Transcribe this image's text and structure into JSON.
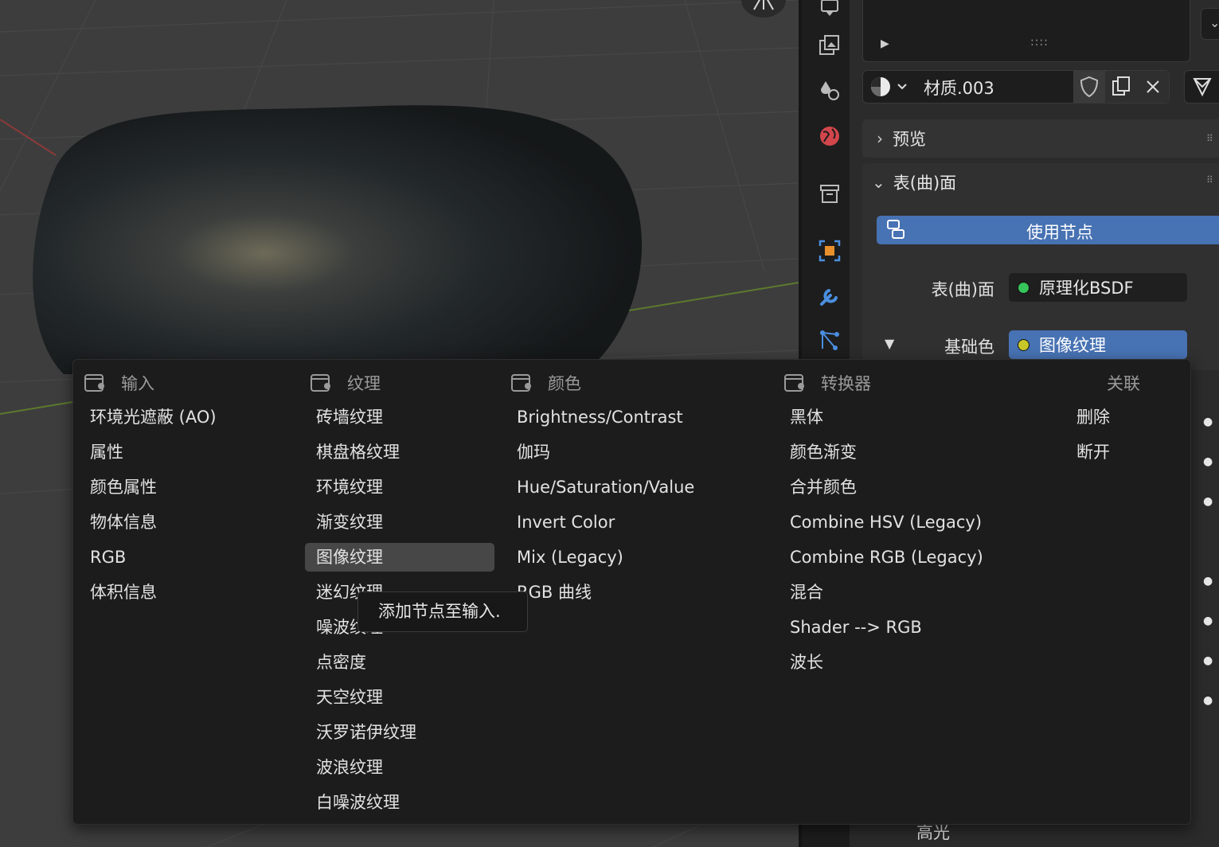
{
  "properties": {
    "material_name": "材质.003",
    "panels": {
      "preview": "预览",
      "surface": "表(曲)面"
    },
    "use_nodes_button": "使用节点",
    "surface_label": "表(曲)面",
    "surface_value": "原理化BSDF",
    "base_color_label": "基础色",
    "base_color_value": "图像纹理",
    "bottom_partial_label": "高光"
  },
  "menu": {
    "columns": {
      "input": {
        "header": "输入",
        "items": [
          "环境光遮蔽 (AO)",
          "属性",
          "颜色属性",
          "物体信息",
          "RGB",
          "体积信息"
        ]
      },
      "texture": {
        "header": "纹理",
        "items": [
          "砖墙纹理",
          "棋盘格纹理",
          "环境纹理",
          "渐变纹理",
          "图像纹理",
          "迷幻纹理",
          "噪波纹理",
          "点密度",
          "天空纹理",
          "沃罗诺伊纹理",
          "波浪纹理",
          "白噪波纹理"
        ],
        "highlighted": "图像纹理"
      },
      "color": {
        "header": "颜色",
        "items": [
          "Brightness/Contrast",
          "伽玛",
          "Hue/Saturation/Value",
          "Invert Color",
          "Mix (Legacy)",
          "RGB 曲线"
        ]
      },
      "converter": {
        "header": "转换器",
        "items": [
          "黑体",
          "颜色渐变",
          "合并颜色",
          "Combine HSV (Legacy)",
          "Combine RGB (Legacy)",
          "混合",
          "Shader --> RGB",
          "波长"
        ]
      },
      "link": {
        "header": "关联",
        "items": [
          "删除",
          "断开"
        ]
      }
    },
    "tooltip": "添加节点至输入."
  },
  "colors": {
    "accent_blue": "#4772b3",
    "socket_green": "#36c55a",
    "socket_yellow": "#c7c729",
    "tab_orange": "#e8902c",
    "tab_blue": "#4a8fe0",
    "tab_red": "#d2464b"
  },
  "icons": [
    "render-icon",
    "output-icon",
    "view-layer-icon",
    "scene-icon",
    "world-icon",
    "collection-icon",
    "object-icon",
    "modifier-wrench-icon",
    "particles-icon",
    "material-sphere-icon",
    "shield-icon",
    "duplicate-icon",
    "close-icon",
    "node-tree-icon",
    "play-icon",
    "chevron-down-icon",
    "chevron-right-icon",
    "node-icon"
  ]
}
